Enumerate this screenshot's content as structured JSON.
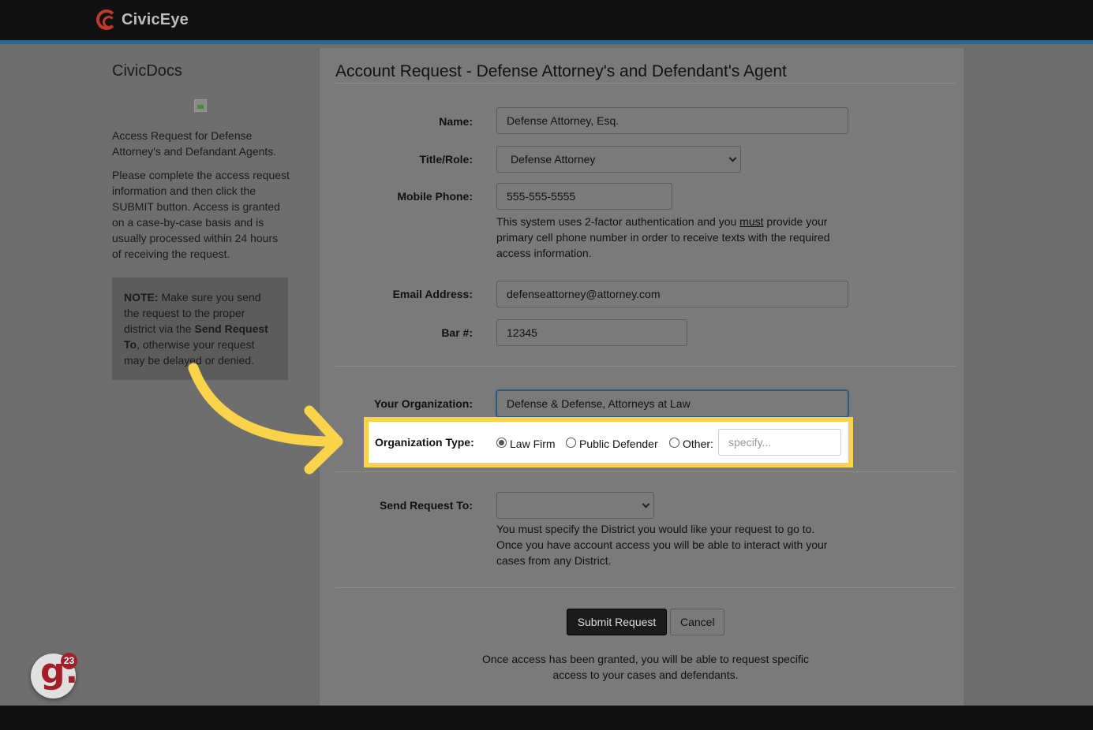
{
  "brand": {
    "name": "CivicEye"
  },
  "sidebar": {
    "title": "CivicDocs",
    "intro": "Access Request for Defense Attorney's and Defandant Agents.",
    "instructions": "Please complete the access request information and then click the SUBMIT button. Access is granted on a case-by-case basis and is usually processed within 24 hours of receiving the request.",
    "note": {
      "label": "NOTE:",
      "text1": " Make sure you send the request to the proper district via the ",
      "bold": "Send Request To",
      "text2": ", otherwise your request may be delayed or denied."
    }
  },
  "main": {
    "title": "Account Request - Defense Attorney's and Defendant's Agent",
    "name": {
      "label": "Name:",
      "value": "Defense Attorney, Esq."
    },
    "title_role": {
      "label": "Title/Role:",
      "value": "Defense Attorney"
    },
    "mobile": {
      "label": "Mobile Phone:",
      "value": "555-555-5555",
      "help_pre": "This system uses 2-factor authentication and you ",
      "help_under": "must",
      "help_post": " provide your primary cell phone number in order to receive texts with the required access information."
    },
    "email": {
      "label": "Email Address:",
      "value": "defenseattorney@attorney.com"
    },
    "bar": {
      "label": "Bar #:",
      "value": "12345"
    },
    "organization": {
      "label": "Your Organization:",
      "value": "Defense & Defense, Attorneys at Law"
    },
    "org_type": {
      "label": "Organization Type:",
      "options": [
        "Law Firm",
        "Public Defender",
        "Other:"
      ],
      "selected": "Law Firm",
      "specify_placeholder": "specify..."
    },
    "send_to": {
      "label": "Send Request To:",
      "value": "",
      "help": "You must specify the District you would like your request to go to. Once you have account access you will be able to interact with your cases from any District."
    },
    "buttons": {
      "submit": "Submit Request",
      "cancel": "Cancel"
    },
    "footer": "Once access has been granted, you will be able to request specific access to your cases and defendants."
  },
  "notification_badge": {
    "letter": "g.",
    "count": "23"
  },
  "colors": {
    "highlight": "#f9d44a",
    "brand_red": "#c0392b",
    "badge_red": "#a21f2a",
    "top_accent": "#1f6b9a"
  }
}
